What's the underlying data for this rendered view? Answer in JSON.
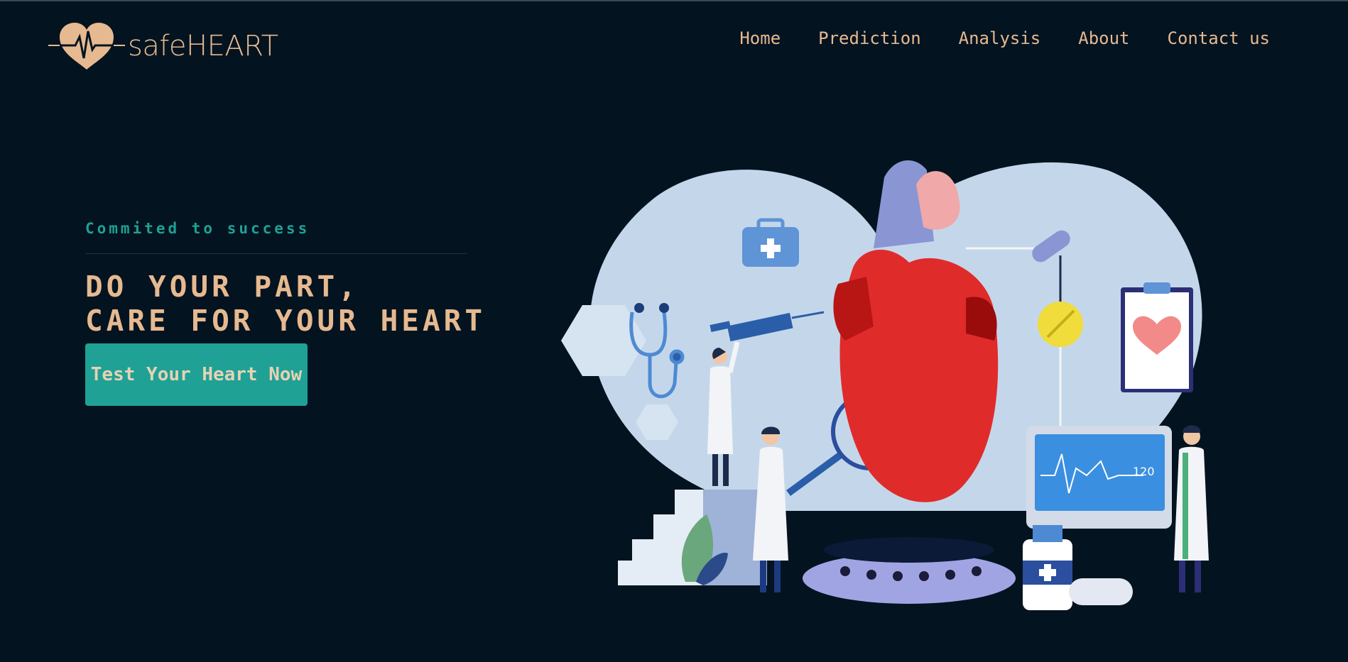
{
  "brand": {
    "name": "safeHEART",
    "logo_icon": "heart-pulse-icon"
  },
  "nav": {
    "items": [
      {
        "label": "Home"
      },
      {
        "label": "Prediction"
      },
      {
        "label": "Analysis"
      },
      {
        "label": "About"
      },
      {
        "label": "Contact us"
      }
    ]
  },
  "hero": {
    "tagline": "Commited to success",
    "headline_line1": "DO YOUR PART,",
    "headline_line2": "CARE FOR YOUR HEART",
    "cta_label": "Test Your Heart Now",
    "illustration_monitor_value": "120"
  },
  "colors": {
    "background": "#041320",
    "accent": "#1fa195",
    "brand_text": "#e6b990"
  }
}
